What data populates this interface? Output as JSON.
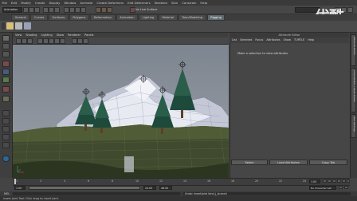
{
  "menu": [
    "File",
    "Edit",
    "Modify",
    "Create",
    "Display",
    "Window",
    "Animate",
    "Create Deformers",
    "Edit Deformers",
    "Skeleton",
    "Skin",
    "Constrain",
    "Help"
  ],
  "status": {
    "mode": "Animation",
    "field_label": "No Live Surface"
  },
  "shelf_tabs": [
    {
      "label": "General",
      "active": false
    },
    {
      "label": "Curves",
      "active": false
    },
    {
      "label": "Surfaces",
      "active": false
    },
    {
      "label": "Polygons",
      "active": false
    },
    {
      "label": "Deformation",
      "active": false
    },
    {
      "label": "Animation",
      "active": false
    },
    {
      "label": "Lighting",
      "active": false
    },
    {
      "label": "Material",
      "active": false
    },
    {
      "label": "Toon/Modeling",
      "active": false
    },
    {
      "label": "Rigging",
      "active": true
    }
  ],
  "viewport_menu": [
    "View",
    "Shading",
    "Lighting",
    "Show",
    "Renderer",
    "Panels"
  ],
  "attribute_editor": {
    "title": "Attribute Editor",
    "menu": [
      "List",
      "Selected",
      "Focus",
      "Attributes",
      "Show",
      "TURTLE",
      "Help"
    ],
    "message": "Make a selection to view attributes.",
    "buttons": {
      "select": "Select",
      "load": "Load Attributes",
      "copy": "Copy Tab"
    }
  },
  "side_tabs": [
    "Attribute Editor",
    "Channel Box / Layer Editor",
    "Tool Settings"
  ],
  "timeline": {
    "ticks": [
      "1",
      "2",
      "4",
      "6",
      "8",
      "10",
      "12",
      "14",
      "16",
      "18",
      "20",
      "22",
      "24"
    ],
    "current_frame": "1.00",
    "range_start": "1.00",
    "range_end": "24.00",
    "anim_end": "48.00",
    "character_set": "No Character Set"
  },
  "command_line": {
    "language": "MEL",
    "result": "Undo: insertJoint bind_j_branch"
  },
  "help_line": "Insert Joint Tool: Click drag to insert joint.",
  "watermark": "优酷",
  "colors": {
    "tree": "#1e4a3c",
    "snow": "#e8eaf2",
    "ground": "#3f4a2e",
    "sky": "#8a9099"
  }
}
